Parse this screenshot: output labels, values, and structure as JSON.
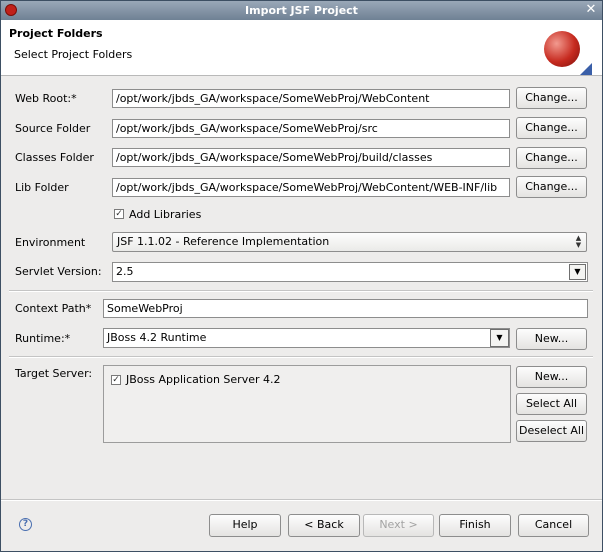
{
  "window": {
    "title": "Import JSF Project",
    "close": "✕"
  },
  "header": {
    "title": "Project Folders",
    "subtitle": "Select Project Folders"
  },
  "form": {
    "web_root": {
      "label": "Web Root:*",
      "value": "/opt/work/jbds_GA/workspace/SomeWebProj/WebContent",
      "button": "Change..."
    },
    "source_folder": {
      "label": "Source Folder",
      "value": "/opt/work/jbds_GA/workspace/SomeWebProj/src",
      "button": "Change..."
    },
    "classes_folder": {
      "label": "Classes Folder",
      "value": "/opt/work/jbds_GA/workspace/SomeWebProj/build/classes",
      "button": "Change..."
    },
    "lib_folder": {
      "label": "Lib Folder",
      "value": "/opt/work/jbds_GA/workspace/SomeWebProj/WebContent/WEB-INF/lib",
      "button": "Change..."
    },
    "add_libraries": {
      "label": "Add Libraries",
      "checked": true
    },
    "environment": {
      "label": "Environment",
      "value": "JSF 1.1.02 - Reference Implementation"
    },
    "servlet_version": {
      "label": "Servlet Version:",
      "value": "2.5"
    },
    "context_path": {
      "label": "Context Path*",
      "value": "SomeWebProj"
    },
    "runtime": {
      "label": "Runtime:*",
      "value": "JBoss 4.2 Runtime",
      "button": "New..."
    },
    "target_server": {
      "label": "Target Server:",
      "items": [
        {
          "label": "JBoss Application Server 4.2",
          "checked": true
        }
      ],
      "new_button": "New...",
      "select_all": "Select All",
      "deselect_all": "Deselect All"
    }
  },
  "footer": {
    "help": "Help",
    "back": "< Back",
    "next": "Next >",
    "finish": "Finish",
    "cancel": "Cancel"
  },
  "icons": {
    "app": "jboss-dev-studio-icon",
    "header_logo": "jsf-wizard-logo-icon",
    "help": "help-icon",
    "check": "✓"
  }
}
